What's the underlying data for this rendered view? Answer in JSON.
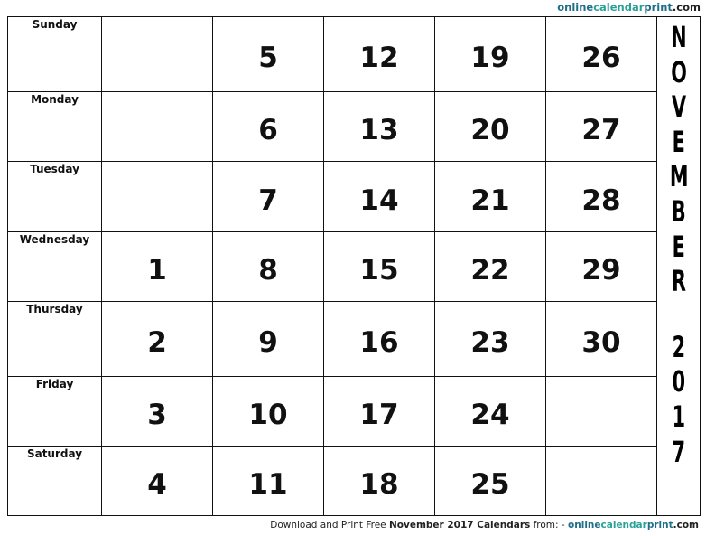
{
  "header": {
    "site_prefix": "online",
    "site_middle": "calendar",
    "site_print": "print",
    "site_tld": ".com"
  },
  "calendar": {
    "month_letters": [
      "N",
      "O",
      "V",
      "E",
      "M",
      "B",
      "E",
      "R"
    ],
    "year_letters": [
      "2",
      "0",
      "1",
      "7"
    ],
    "rows": [
      {
        "day": "Sunday",
        "dates": [
          "",
          "5",
          "12",
          "19",
          "26"
        ]
      },
      {
        "day": "Monday",
        "dates": [
          "",
          "6",
          "13",
          "20",
          "27"
        ]
      },
      {
        "day": "Tuesday",
        "dates": [
          "",
          "7",
          "14",
          "21",
          "28"
        ]
      },
      {
        "day": "Wednesday",
        "dates": [
          "1",
          "8",
          "15",
          "22",
          "29"
        ]
      },
      {
        "day": "Thursday",
        "dates": [
          "2",
          "9",
          "16",
          "23",
          "30"
        ]
      },
      {
        "day": "Friday",
        "dates": [
          "3",
          "10",
          "17",
          "24",
          ""
        ]
      },
      {
        "day": "Saturday",
        "dates": [
          "4",
          "11",
          "18",
          "25",
          ""
        ]
      }
    ]
  },
  "footer": {
    "text_before": "Download and Print Free ",
    "bold_text": "November 2017 Calendars",
    "text_after": " from: - ",
    "site_prefix": "online",
    "site_middle": "calendar",
    "site_print": "print",
    "site_tld": ".com"
  },
  "colors": {
    "site_blue": "#1f6f8b",
    "site_green": "#2aa198",
    "border": "#111111"
  }
}
